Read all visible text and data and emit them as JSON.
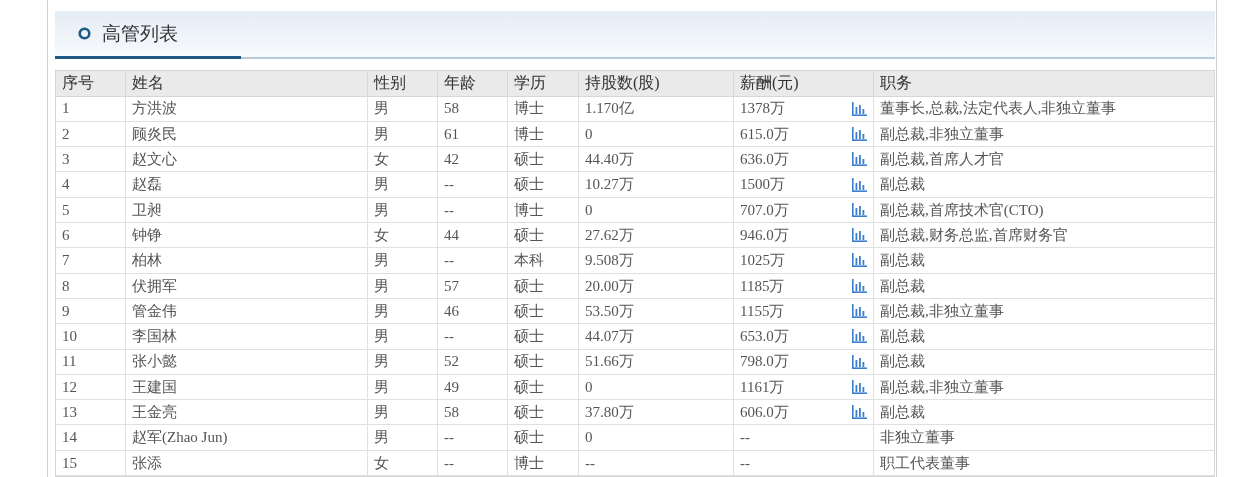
{
  "panel": {
    "title": "高管列表"
  },
  "table": {
    "columns": [
      "序号",
      "姓名",
      "性别",
      "年龄",
      "学历",
      "持股数(股)",
      "薪酬(元)",
      "职务"
    ],
    "rows": [
      {
        "cells": [
          "1",
          "方洪波",
          "男",
          "58",
          "博士",
          "1.170亿",
          "1378万",
          "董事长,总裁,法定代表人,非独立董事"
        ],
        "chart_link": true
      },
      {
        "cells": [
          "2",
          "顾炎民",
          "男",
          "61",
          "博士",
          "0",
          "615.0万",
          "副总裁,非独立董事"
        ],
        "chart_link": true
      },
      {
        "cells": [
          "3",
          "赵文心",
          "女",
          "42",
          "硕士",
          "44.40万",
          "636.0万",
          "副总裁,首席人才官"
        ],
        "chart_link": true
      },
      {
        "cells": [
          "4",
          "赵磊",
          "男",
          "--",
          "硕士",
          "10.27万",
          "1500万",
          "副总裁"
        ],
        "chart_link": true
      },
      {
        "cells": [
          "5",
          "卫昶",
          "男",
          "--",
          "博士",
          "0",
          "707.0万",
          "副总裁,首席技术官(CTO)"
        ],
        "chart_link": true
      },
      {
        "cells": [
          "6",
          "钟铮",
          "女",
          "44",
          "硕士",
          "27.62万",
          "946.0万",
          "副总裁,财务总监,首席财务官"
        ],
        "chart_link": true
      },
      {
        "cells": [
          "7",
          "柏林",
          "男",
          "--",
          "本科",
          "9.508万",
          "1025万",
          "副总裁"
        ],
        "chart_link": true
      },
      {
        "cells": [
          "8",
          "伏拥军",
          "男",
          "57",
          "硕士",
          "20.00万",
          "1185万",
          "副总裁"
        ],
        "chart_link": true
      },
      {
        "cells": [
          "9",
          "管金伟",
          "男",
          "46",
          "硕士",
          "53.50万",
          "1155万",
          "副总裁,非独立董事"
        ],
        "chart_link": true
      },
      {
        "cells": [
          "10",
          "李国林",
          "男",
          "--",
          "硕士",
          "44.07万",
          "653.0万",
          "副总裁"
        ],
        "chart_link": true
      },
      {
        "cells": [
          "11",
          "张小懿",
          "男",
          "52",
          "硕士",
          "51.66万",
          "798.0万",
          "副总裁"
        ],
        "chart_link": true
      },
      {
        "cells": [
          "12",
          "王建国",
          "男",
          "49",
          "硕士",
          "0",
          "1161万",
          "副总裁,非独立董事"
        ],
        "chart_link": true
      },
      {
        "cells": [
          "13",
          "王金亮",
          "男",
          "58",
          "硕士",
          "37.80万",
          "606.0万",
          "副总裁"
        ],
        "chart_link": true
      },
      {
        "cells": [
          "14",
          "赵军(Zhao Jun)",
          "男",
          "--",
          "硕士",
          "0",
          "--",
          "非独立董事"
        ],
        "chart_link": false
      },
      {
        "cells": [
          "15",
          "张添",
          "女",
          "--",
          "博士",
          "--",
          "--",
          "职工代表董事"
        ],
        "chart_link": false
      }
    ]
  }
}
